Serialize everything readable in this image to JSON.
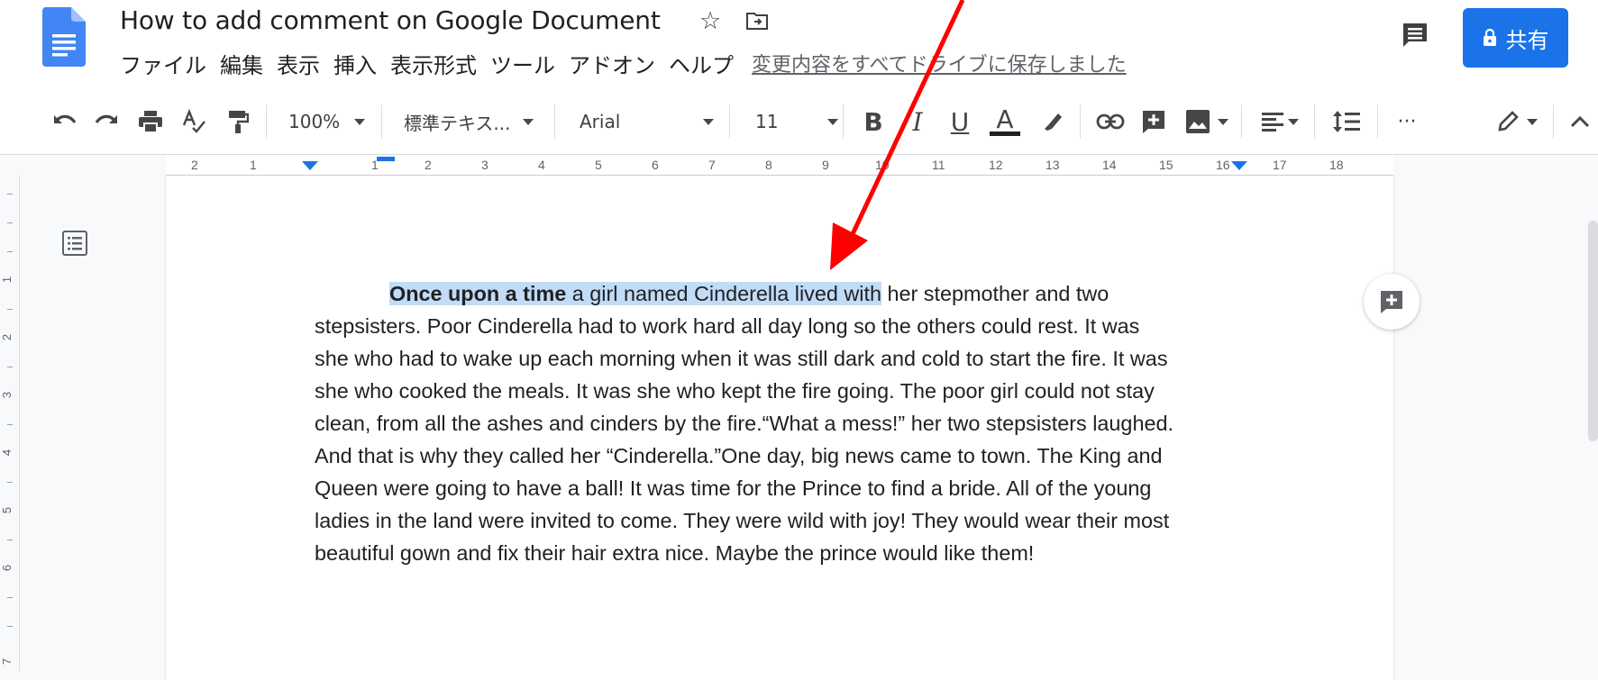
{
  "document": {
    "title": "How to add comment on Google Document",
    "save_status": "変更内容をすべてドライブに保存しました"
  },
  "menu": [
    "ファイル",
    "編集",
    "表示",
    "挿入",
    "表示形式",
    "ツール",
    "アドオン",
    "ヘルプ"
  ],
  "share_button": {
    "label": "共有"
  },
  "toolbar": {
    "zoom": "100%",
    "style": "標準テキス...",
    "font": "Arial",
    "font_size": "11",
    "bold_label": "B",
    "italic_label": "I",
    "underline_label": "U",
    "text_color_label": "A",
    "more_label": "···"
  },
  "ruler": {
    "numbers": [
      "2",
      "1",
      "1",
      "2",
      "3",
      "4",
      "5",
      "6",
      "7",
      "8",
      "9",
      "10",
      "11",
      "12",
      "13",
      "14",
      "15",
      "16",
      "17",
      "18"
    ]
  },
  "vertical_ruler": {
    "numbers": [
      "1",
      "2",
      "3",
      "4",
      "5",
      "6",
      "7"
    ]
  },
  "body": {
    "line1_bold": "Once upon a time",
    "line1_selected": " a girl named Cinderella lived with",
    "line1_rest": " her stepmother and two",
    "lines": [
      "stepsisters.  Poor Cinderella had to work hard all day long so the others could rest. It was",
      "she who had to wake up each morning when it was still dark and cold to start the fire.  It was",
      "she who cooked the meals. It was she who kept the fire going. The poor girl could not stay",
      "clean, from all the ashes and cinders by the fire.“What a mess!” her two stepsisters laughed.",
      "And that is why they called her “Cinderella.”One day, big news came to town.  The King and",
      "Queen were going to have a ball!  It was time for the Prince to find a bride. All of the young",
      "ladies in the land were invited to come.  They were wild with joy! They would wear their most",
      "beautiful gown and fix their hair extra nice. Maybe the prince would like them!"
    ]
  },
  "colors": {
    "accent": "#1a73e8",
    "selection": "#c2dbf7",
    "annotation_arrow": "#ff0000"
  },
  "icons": [
    "docs-logo-icon",
    "star-icon",
    "move-to-folder-icon",
    "comment-history-icon",
    "lock-icon",
    "undo-icon",
    "redo-icon",
    "print-icon",
    "spellcheck-icon",
    "paint-format-icon",
    "highlight-icon",
    "link-icon",
    "add-comment-icon",
    "insert-image-icon",
    "align-icon",
    "line-spacing-icon",
    "edit-mode-icon",
    "collapse-icon",
    "outline-icon"
  ]
}
